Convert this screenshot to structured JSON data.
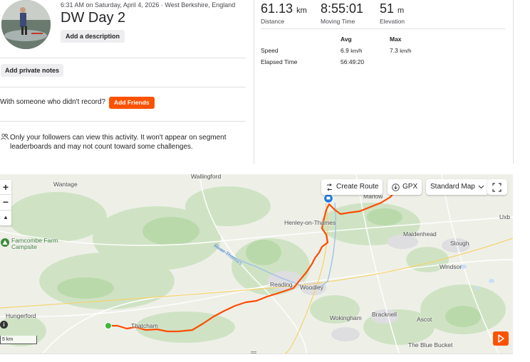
{
  "activity": {
    "meta": "6:31 AM on Saturday, April 4, 2026 · West Berkshire, England",
    "title": "DW Day 2",
    "add_description": "Add a description",
    "add_private_notes": "Add private notes",
    "friends_prompt": "With someone who didn't record?",
    "add_friends": "Add Friends",
    "privacy_notice": "Only your followers can view this activity. It won't appear on segment leaderboards and may not count toward some challenges."
  },
  "stats": {
    "distance": {
      "value": "61.13",
      "unit": "km",
      "label": "Distance"
    },
    "moving_time": {
      "value": "8:55:01",
      "label": "Moving Time"
    },
    "elevation": {
      "value": "51",
      "unit": "m",
      "label": "Elevation"
    }
  },
  "table": {
    "col_avg": "Avg",
    "col_max": "Max",
    "rows": [
      {
        "label": "Speed",
        "avg": "6.9",
        "avg_unit": "km/h",
        "max": "7.3",
        "max_unit": "km/h"
      },
      {
        "label": "Elapsed Time",
        "avg": "56:49:20",
        "avg_unit": "",
        "max": "",
        "max_unit": ""
      }
    ]
  },
  "map": {
    "create_route": "Create Route",
    "gpx": "GPX",
    "map_type": "Standard Map",
    "zoom_in": "+",
    "zoom_out": "−",
    "compass": "▲",
    "scale": "5 km",
    "info": "i",
    "river": "River Thames",
    "places": {
      "wallingford": "Wallingford",
      "wantage": "Wantage",
      "marlow": "Marlow",
      "uxbridge": "Uxb",
      "henley": "Henley-on-Thames",
      "maidenhead": "Maidenhead",
      "slough": "Slough",
      "farncombe1": "Farncombe Farm",
      "farncombe2": "Campsite",
      "windsor": "Windsor",
      "reading": "Reading",
      "woodley": "Woodley",
      "hungerford": "Hungerford",
      "thatcham": "Thatcham",
      "wokingham": "Wokingham",
      "bracknell": "Bracknell",
      "ascot": "Ascot",
      "bluebucket": "The Blue Bucket"
    },
    "colors": {
      "route": "#fc4c02",
      "start": "#3eb83e",
      "end": "#1f7be0",
      "accent": "#fc5200"
    }
  }
}
